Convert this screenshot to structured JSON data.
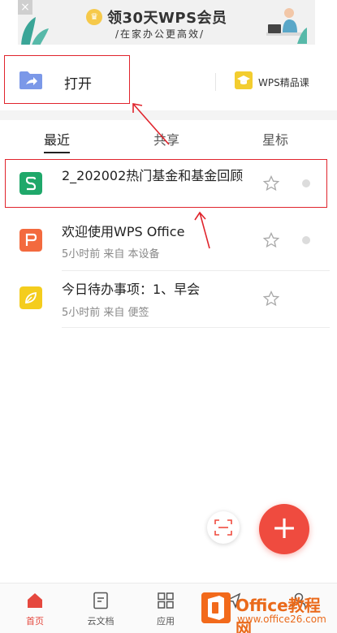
{
  "banner": {
    "title": "领30天WPS会员",
    "subtitle": "/在家办公更高效/",
    "close_glyph": "×"
  },
  "open": {
    "label": "打开"
  },
  "course": {
    "label": "WPS精品课"
  },
  "tabs": [
    {
      "label": "最近",
      "active": true
    },
    {
      "label": "共享",
      "active": false
    },
    {
      "label": "星标",
      "active": false
    }
  ],
  "files": [
    {
      "name": "2_202002热门基金和基金回顾",
      "meta": "",
      "icon": "sheet-icon",
      "color": "#1fa86a",
      "glyph": "S"
    },
    {
      "name": "欢迎使用WPS Office",
      "meta": "5小时前    来自 本设备",
      "icon": "ppt-icon",
      "color": "#f36a3e",
      "glyph": "P"
    },
    {
      "name": "今日待办事项：1、早会",
      "meta": "5小时前    来自 便签",
      "icon": "note-icon",
      "color": "#f4cd1d",
      "glyph": ""
    }
  ],
  "fab": {
    "add": "+"
  },
  "nav": [
    {
      "label": "首页",
      "icon": "home-icon",
      "active": true
    },
    {
      "label": "云文档",
      "icon": "cloud-doc-icon",
      "active": false
    },
    {
      "label": "应用",
      "icon": "apps-icon",
      "active": false
    },
    {
      "label": "",
      "icon": "send-icon",
      "active": false
    },
    {
      "label": "",
      "icon": "profile-icon",
      "active": false
    }
  ],
  "watermark": {
    "title": "Office教程网",
    "url": "www.office26.com"
  },
  "colors": {
    "accent": "#ef4b3f",
    "annotation": "#e0242c"
  }
}
